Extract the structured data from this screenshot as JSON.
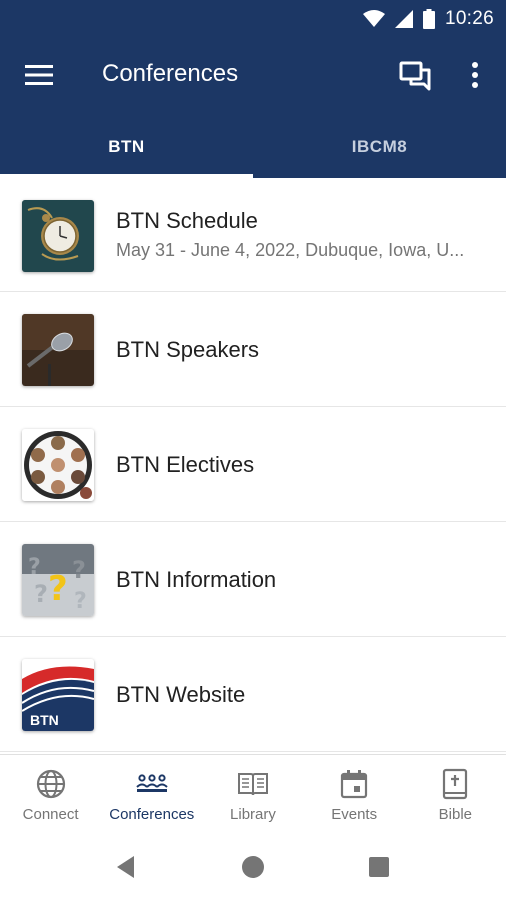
{
  "status_bar": {
    "time": "10:26",
    "icons": [
      "wifi-icon",
      "signal-icon",
      "battery-icon"
    ]
  },
  "app_bar": {
    "title": "Conferences",
    "actions": [
      "menu-icon",
      "chat-icon",
      "more-vert-icon"
    ]
  },
  "tabs": [
    {
      "label": "BTN",
      "active": true
    },
    {
      "label": "IBCM8",
      "active": false
    }
  ],
  "list": [
    {
      "title": "BTN Schedule",
      "subtitle": "May 31 - June 4, 2022, Dubuque, Iowa, U...",
      "thumbnail": "pocket-watch-thumbnail"
    },
    {
      "title": "BTN Speakers",
      "thumbnail": "microphone-thumbnail"
    },
    {
      "title": "BTN Electives",
      "thumbnail": "electives-collage-thumbnail"
    },
    {
      "title": "BTN Information",
      "thumbnail": "question-marks-thumbnail"
    },
    {
      "title": "BTN Website",
      "thumbnail": "btn-logo-thumbnail",
      "logo_text": "BTN"
    }
  ],
  "bottom_nav": [
    {
      "label": "Connect",
      "icon": "globe-icon",
      "active": false
    },
    {
      "label": "Conferences",
      "icon": "conferences-icon",
      "active": true
    },
    {
      "label": "Library",
      "icon": "book-icon",
      "active": false
    },
    {
      "label": "Events",
      "icon": "calendar-icon",
      "active": false
    },
    {
      "label": "Bible",
      "icon": "bible-icon",
      "active": false
    }
  ],
  "colors": {
    "primary": "#1c3765",
    "tab_inactive": "#c6cfde",
    "text_primary": "#212121",
    "text_secondary": "#757575"
  }
}
